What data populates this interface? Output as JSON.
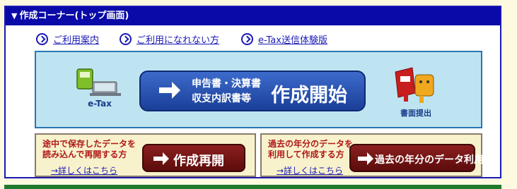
{
  "header": {
    "title": "作成コーナー(トップ画面)"
  },
  "nav_links": [
    {
      "label": "ご利用案内"
    },
    {
      "label": "ご利用になれない方"
    },
    {
      "label": "e-Tax送信体験版"
    }
  ],
  "start": {
    "etax_label": "e-Tax",
    "line1": "申告書・決算書",
    "line2": "収支内訳書等",
    "main": "作成開始",
    "submit_label": "書面提出"
  },
  "resume": {
    "desc_line1": "途中で保存したデータを",
    "desc_line2": "読み込んで再開する方",
    "button": "作成再開",
    "link": "→詳しくはこちら"
  },
  "past": {
    "desc_line1": "過去の年分のデータを",
    "desc_line2": "利用して作成する方",
    "button": "過去の年分のデータ利用",
    "link": "→詳しくはこちら"
  },
  "colors": {
    "header_bg": "#0a0aa8",
    "start_bg": "#bfe4f1",
    "start_button": "#2a56b4",
    "red_button": "#7a1414",
    "sub_box_bg": "#f8f2cc",
    "page_bg": "#fdfae0"
  }
}
